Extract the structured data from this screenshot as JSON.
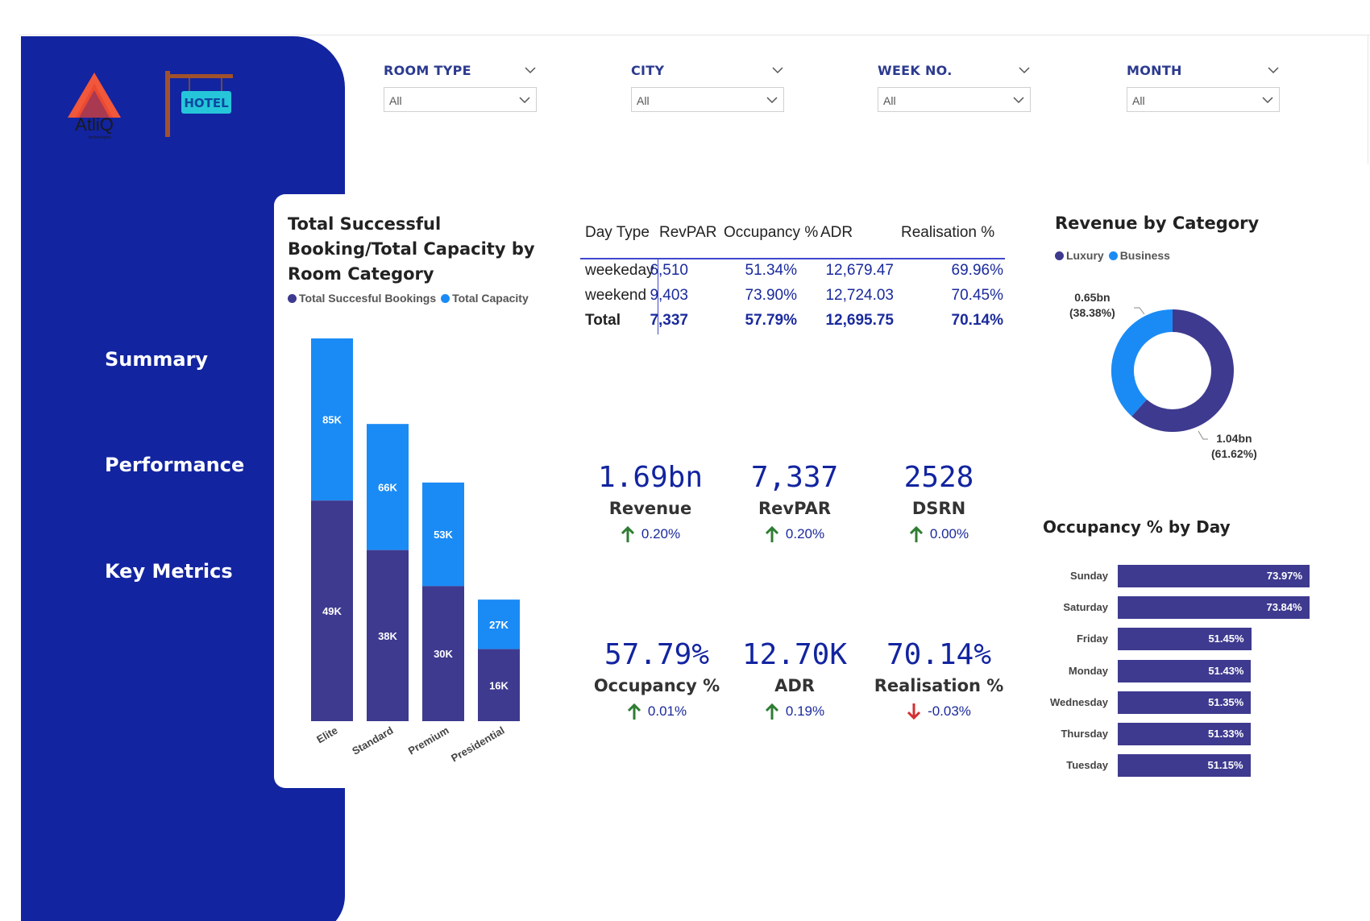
{
  "filters": [
    {
      "label": "ROOM TYPE",
      "value": "All"
    },
    {
      "label": "CITY",
      "value": "All"
    },
    {
      "label": "WEEK NO.",
      "value": "All"
    },
    {
      "label": "MONTH",
      "value": "All"
    }
  ],
  "logos": {
    "atliq_text": "AtliQ",
    "atliq_sub": "technologies",
    "hotel_sign": "HOTEL"
  },
  "nav": {
    "summary": "Summary",
    "performance": "Performance",
    "key_metrics": "Key Metrics"
  },
  "colors": {
    "sidebar": "#1224a0",
    "bookings": "#3e3a8f",
    "capacity": "#1a8bf5",
    "positive": "#2e7d32",
    "negative": "#d32f2f"
  },
  "bar_chart": {
    "title": "Total Successful Booking/Total Capacity by Room Category",
    "legend": [
      "Total Succesful Bookings",
      "Total Capacity"
    ]
  },
  "kpi_table": {
    "headers": [
      "Day Type",
      "RevPAR",
      "Occupancy %",
      "ADR",
      "Realisation %"
    ],
    "rows": [
      [
        "weekeday",
        "6,510",
        "51.34%",
        "12,679.47",
        "69.96%"
      ],
      [
        "weekend",
        "9,403",
        "73.90%",
        "12,724.03",
        "70.45%"
      ]
    ],
    "total": [
      "Total",
      "7,337",
      "57.79%",
      "12,695.75",
      "70.14%"
    ]
  },
  "cards": [
    {
      "value": "1.69bn",
      "label": "Revenue",
      "delta": "0.20%",
      "trend": "up"
    },
    {
      "value": "7,337",
      "label": "RevPAR",
      "delta": "0.20%",
      "trend": "up"
    },
    {
      "value": "2528",
      "label": "DSRN",
      "delta": "0.00%",
      "trend": "up"
    },
    {
      "value": "57.79%",
      "label": "Occupancy %",
      "delta": "0.01%",
      "trend": "up"
    },
    {
      "value": "12.70K",
      "label": "ADR",
      "delta": "0.19%",
      "trend": "up"
    },
    {
      "value": "70.14%",
      "label": "Realisation %",
      "delta": "-0.03%",
      "trend": "down"
    }
  ],
  "donut": {
    "title": "Revenue by Category",
    "legend": [
      "Luxury",
      "Business"
    ],
    "business_label": [
      "0.65bn",
      "(38.38%)"
    ],
    "luxury_label": [
      "1.04bn",
      "(61.62%)"
    ]
  },
  "occupancy_by_day": {
    "title": "Occupancy % by Day"
  },
  "chart_data": [
    {
      "type": "bar",
      "title": "Total Successful Booking/Total Capacity by Room Category",
      "categories": [
        "Elite",
        "Standard",
        "Premium",
        "Presidential"
      ],
      "series": [
        {
          "name": "Total Succesful Bookings",
          "values": [
            49,
            38,
            30,
            16
          ],
          "labels": [
            "49K",
            "38K",
            "30K",
            "16K"
          ]
        },
        {
          "name": "Total Capacity",
          "values": [
            85,
            66,
            53,
            27
          ],
          "labels": [
            "85K",
            "66K",
            "53K",
            "27K"
          ]
        }
      ],
      "stacked": true
    },
    {
      "type": "pie",
      "title": "Revenue by Category",
      "categories": [
        "Luxury",
        "Business"
      ],
      "values": [
        61.62,
        38.38
      ]
    },
    {
      "type": "bar",
      "orientation": "horizontal",
      "title": "Occupancy % by Day",
      "categories": [
        "Sunday",
        "Saturday",
        "Friday",
        "Monday",
        "Wednesday",
        "Thursday",
        "Tuesday"
      ],
      "values": [
        73.97,
        73.84,
        51.45,
        51.43,
        51.35,
        51.33,
        51.15
      ],
      "labels": [
        "73.97%",
        "73.84%",
        "51.45%",
        "51.43%",
        "51.35%",
        "51.33%",
        "51.15%"
      ]
    }
  ]
}
